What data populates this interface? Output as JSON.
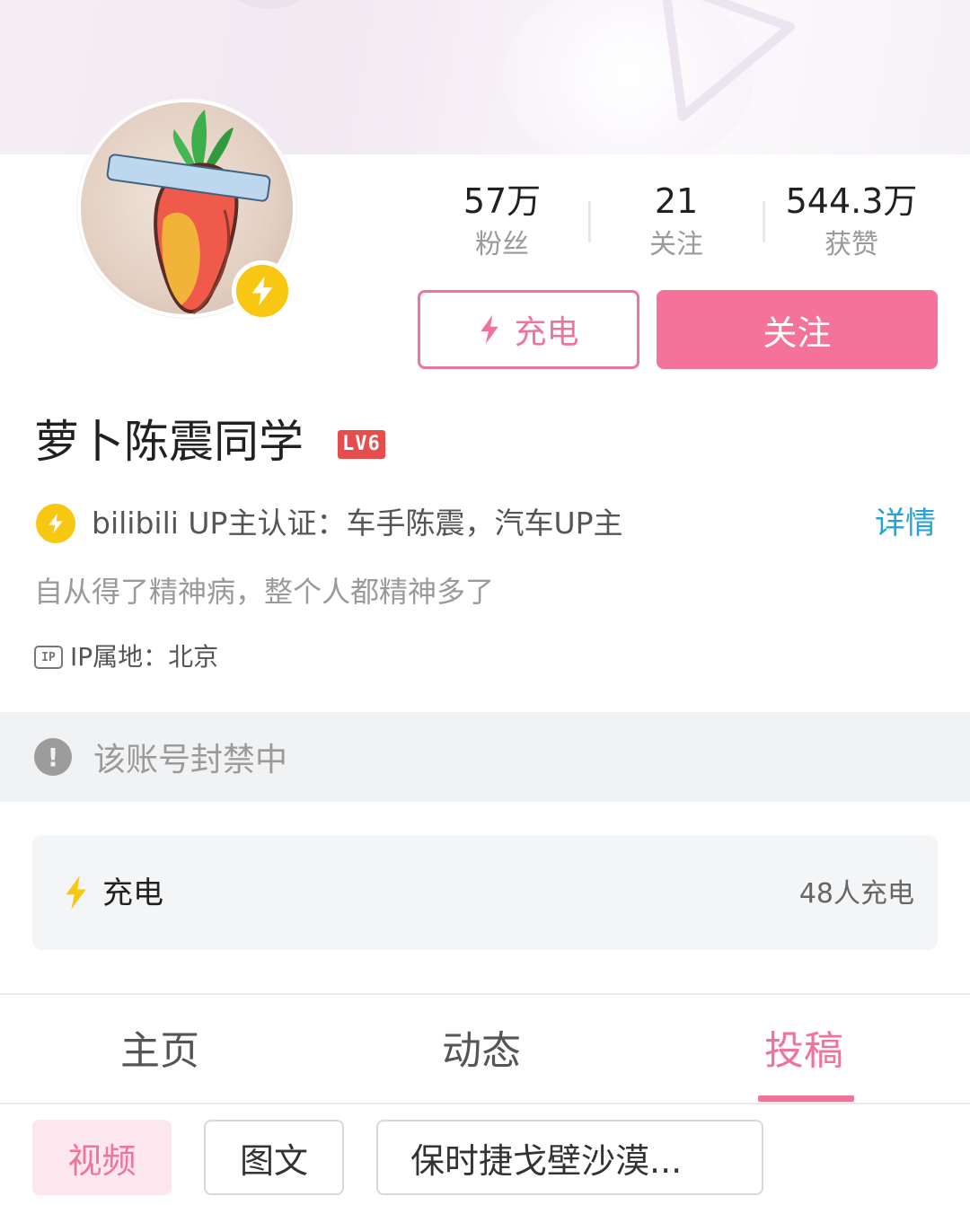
{
  "profile": {
    "name": "萝卜陈震同学",
    "level_badge": "LV6",
    "stats": [
      {
        "value": "57万",
        "label": "粉丝"
      },
      {
        "value": "21",
        "label": "关注"
      },
      {
        "value": "544.3万",
        "label": "获赞"
      }
    ],
    "charge_button_label": "充电",
    "follow_button_label": "关注",
    "certification": "bilibili UP主认证：车手陈震，汽车UP主",
    "detail_link": "详情",
    "signature": "自从得了精神病，整个人都精神多了",
    "ip_icon_label": "IP",
    "ip_location": "IP属地：北京",
    "banned_notice": "该账号封禁中"
  },
  "charge_card": {
    "label": "充电",
    "count": "48人充电"
  },
  "tabs": [
    {
      "label": "主页",
      "active": false
    },
    {
      "label": "动态",
      "active": false
    },
    {
      "label": "投稿",
      "active": true
    }
  ],
  "sub_tabs": [
    {
      "label": "视频",
      "active": true
    },
    {
      "label": "图文",
      "active": false
    },
    {
      "label": "保时捷戈壁沙漠...",
      "active": false
    }
  ],
  "colors": {
    "accent_pink": "#f0739a",
    "follow_pink": "#f5729a",
    "bolt_yellow": "#f8c712",
    "link_blue": "#23a3d8",
    "level_red": "#e84d4d"
  },
  "icons": {
    "avatar_badge": "lightning-bolt-icon",
    "charge_button": "lightning-bolt-icon",
    "certification": "lightning-bolt-icon",
    "ip": "ip-icon",
    "banned": "exclamation-icon",
    "charge_card": "lightning-bolt-icon"
  }
}
